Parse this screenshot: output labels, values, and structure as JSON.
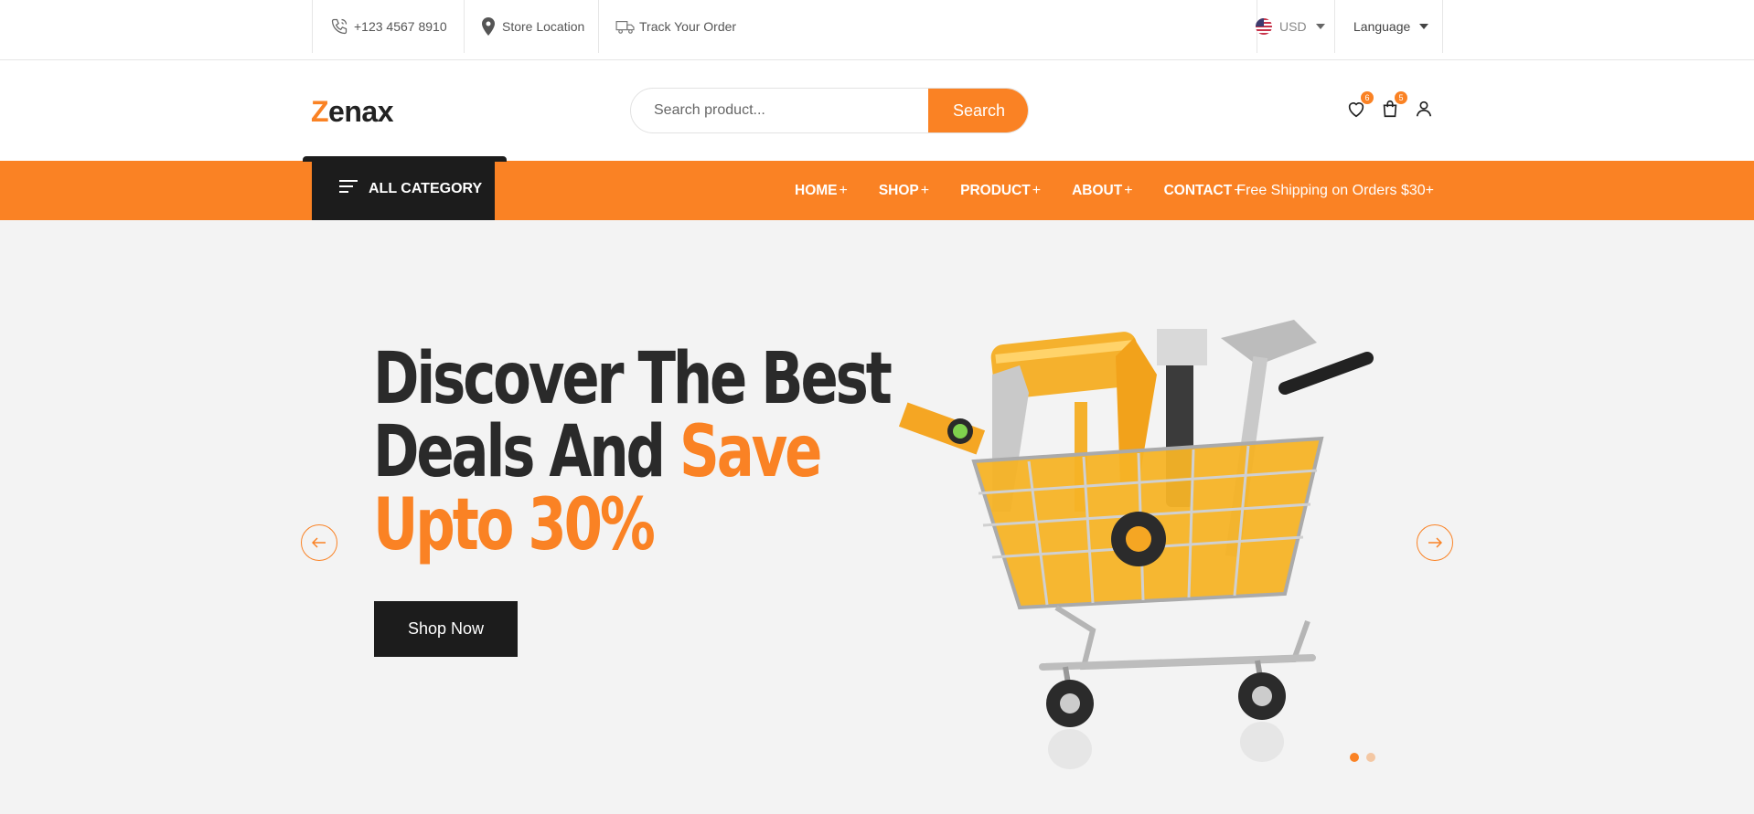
{
  "topbar": {
    "phone": "+123 4567 8910",
    "store_location": "Store Location",
    "track_order": "Track Your Order",
    "currency": "USD",
    "language": "Language"
  },
  "header": {
    "logo_first": "Z",
    "logo_rest": "enax",
    "search_placeholder": "Search product...",
    "search_button": "Search",
    "wishlist_count": "6",
    "cart_count": "5"
  },
  "nav": {
    "all_category": "ALL CATEGORY",
    "items": [
      {
        "label": "HOME",
        "plus": "+"
      },
      {
        "label": "SHOP",
        "plus": "+"
      },
      {
        "label": "PRODUCT",
        "plus": "+"
      },
      {
        "label": "ABOUT",
        "plus": "+"
      },
      {
        "label": "CONTACT",
        "plus": "+"
      }
    ],
    "free_shipping": "Free Shipping on Orders $30+"
  },
  "hero": {
    "line1": "Discover The Best",
    "line2_dark": "Deals And ",
    "line2_accent": "Save",
    "line3_accent": "Upto 30%",
    "shop_button": "Shop Now",
    "slide_count": 2,
    "active_slide": 1
  },
  "colors": {
    "accent": "#fa8224",
    "dark": "#1c1c1c",
    "hero_bg": "#f3f3f3"
  }
}
